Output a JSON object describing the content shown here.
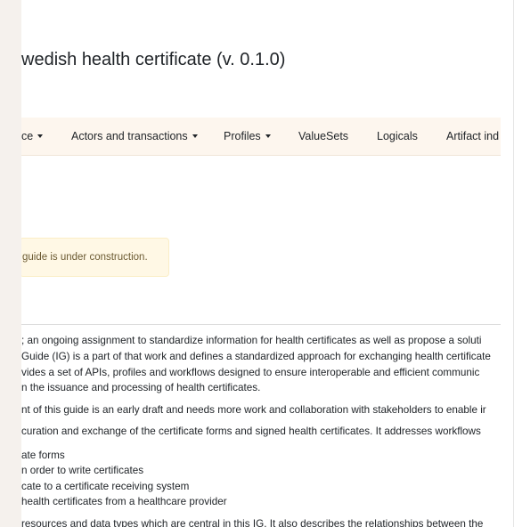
{
  "title": "wedish health certificate (v. 0.1.0)",
  "nav": {
    "items": [
      {
        "label": "ce",
        "dropdown": true
      },
      {
        "label": "Actors and transactions",
        "dropdown": true
      },
      {
        "label": "Profiles",
        "dropdown": true
      },
      {
        "label": "ValueSets",
        "dropdown": false
      },
      {
        "label": "Logicals",
        "dropdown": false
      },
      {
        "label": "Artifact ind",
        "dropdown": false
      }
    ]
  },
  "alert": {
    "text": "guide is under construction."
  },
  "content": {
    "para1": [
      "; an ongoing assignment to standardize information for health certificates as well as propose a soluti",
      "Guide (IG) is a part of that work and defines a standardized approach for exchanging health certificate",
      "vides a set of APIs, profiles and workflows designed to ensure interoperable and efficient communic",
      "n the issuance and processing of health certificates."
    ],
    "para2": "nt of this guide is an early draft and needs more work and collaboration with stakeholders to enable ir",
    "para3": "curation and exchange of the certificate forms and signed health certificates. It addresses workflows",
    "list": [
      "ate forms",
      "n order to write certificates",
      "cate to a certificate receiving system",
      "health certificates from a healthcare provider"
    ],
    "para4": "resources and data types which are central in this IG. It also describes the relationships between the"
  },
  "colors": {
    "page_bg": "#ffffff",
    "outer_bg": "#f5f1ed",
    "navbar_bg": "#fdf6ee",
    "alert_bg": "#fff8e5",
    "alert_border": "#fbeec6",
    "text": "#212529"
  }
}
